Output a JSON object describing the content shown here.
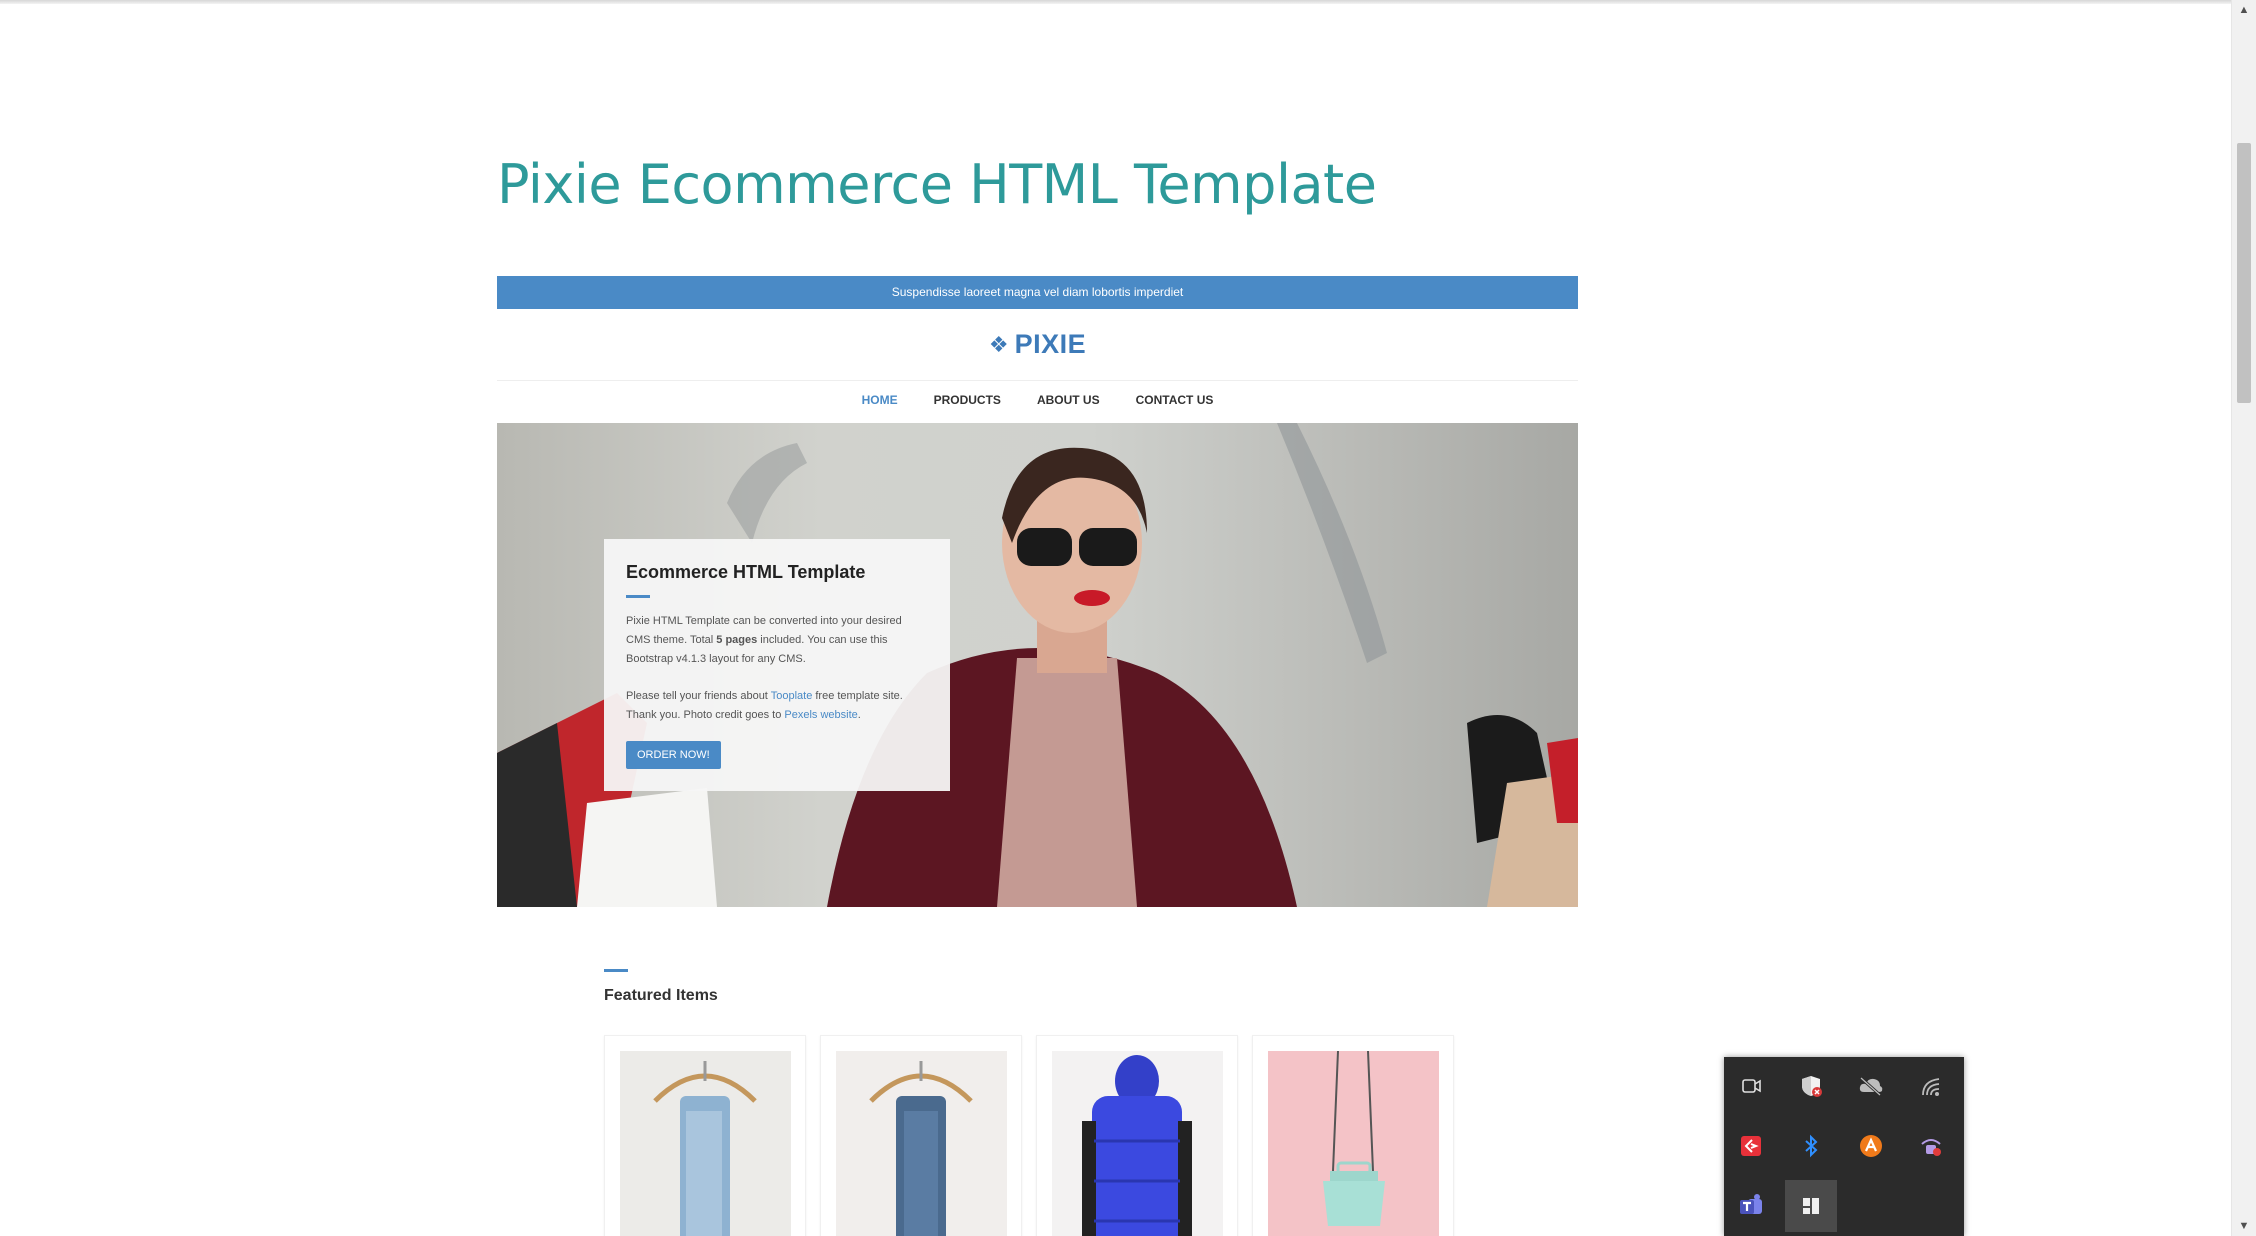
{
  "page": {
    "title": "Pixie Ecommerce HTML Template"
  },
  "preview": {
    "announcement": "Suspendisse laoreet magna vel diam lobortis imperdiet",
    "brand": "PIXIE",
    "brand_icon": "logo-diamond-icon",
    "nav": [
      {
        "label": "HOME",
        "active": true
      },
      {
        "label": "PRODUCTS",
        "active": false
      },
      {
        "label": "ABOUT US",
        "active": false
      },
      {
        "label": "CONTACT US",
        "active": false
      }
    ],
    "hero": {
      "heading": "Ecommerce HTML Template",
      "p1_a": "Pixie HTML Template can be converted into your desired CMS theme. Total ",
      "p1_bold": "5 pages",
      "p1_b": " included. You can use this Bootstrap v4.1.3 layout for any CMS.",
      "p2_a": "Please tell your friends about ",
      "p2_link1": "Tooplate",
      "p2_b": " free template site. Thank you. Photo credit goes to ",
      "p2_link2": "Pexels website",
      "p2_c": ".",
      "button": "ORDER NOW!"
    },
    "featured": {
      "title": "Featured Items"
    },
    "products": [
      {
        "image": "jeans-on-hanger"
      },
      {
        "image": "dark-jeans-on-hanger"
      },
      {
        "image": "blue-puffer-vest"
      },
      {
        "image": "mint-handbag"
      }
    ]
  },
  "tray": {
    "icons": [
      "meet-now-icon",
      "security-shield-icon",
      "cloud-sync-icon",
      "wifi-signal-icon",
      "remote-desktop-icon",
      "bluetooth-icon",
      "avast-icon",
      "vpn-lock-icon",
      "teams-icon",
      "snap-layout-icon"
    ]
  },
  "colors": {
    "title": "#2e9a9a",
    "accent": "#4a8ac6",
    "tray_bg": "#2b2b2b"
  }
}
